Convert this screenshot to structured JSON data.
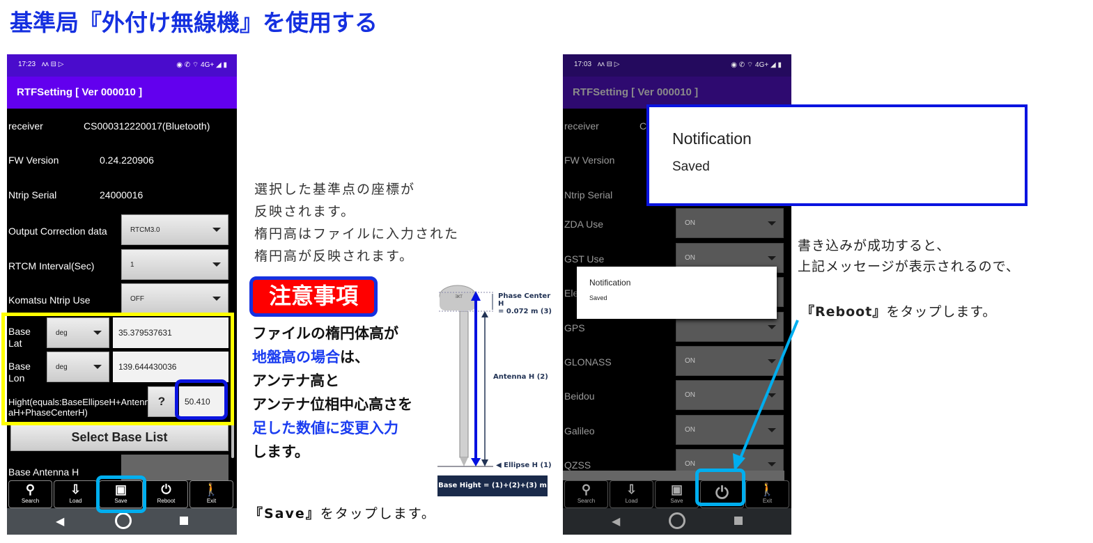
{
  "page_title": "基準局『外付け無線機』を使用する",
  "left_phone": {
    "status_time": "17:23",
    "status_icons": "◉ ✆ ⌔ 4G+ ◢ ▮",
    "app_title": "RTFSetting  [ Ver 000010 ]",
    "rows": [
      {
        "label": "receiver",
        "value": "CS000312220017(Bluetooth)"
      },
      {
        "label": "FW Version",
        "value": "0.24.220906"
      },
      {
        "label": "Ntrip Serial",
        "value": "24000016"
      }
    ],
    "dropdowns": [
      {
        "label": "Output Correction data",
        "value": "RTCM3.0"
      },
      {
        "label": "RTCM Interval(Sec)",
        "value": "1"
      },
      {
        "label": "Komatsu Ntrip Use",
        "value": "OFF"
      }
    ],
    "base_lat": {
      "label": "Base Lat",
      "unit": "deg",
      "value": "35.379537631"
    },
    "base_lon": {
      "label": "Base Lon",
      "unit": "deg",
      "value": "139.644430036"
    },
    "hight": {
      "label": "Hight(equals:BaseEllipseH+AntennaH+PhaseCenterH)",
      "help": "?",
      "value": "50.410"
    },
    "select_base_list": "Select Base List",
    "base_antenna_h": "Base Antenna H"
  },
  "toolbar": [
    {
      "label": "Search",
      "icon": "search-icon"
    },
    {
      "label": "Load",
      "icon": "load-icon"
    },
    {
      "label": "Save",
      "icon": "save-icon"
    },
    {
      "label": "Reboot",
      "icon": "power-icon"
    },
    {
      "label": "Exit",
      "icon": "exit-icon"
    }
  ],
  "middle": {
    "caption_lines": [
      "選択した基準点の座標が",
      "反映されます。",
      "楕円高はファイルに入力された",
      "楕円高が反映されます。"
    ],
    "caution_badge": "注意事項",
    "caution": {
      "l1": "ファイルの楕円体高が",
      "l2_blue": "地盤高の場合",
      "l2_rest": "は、",
      "l3": "アンテナ高と",
      "l4": "アンテナ位相中心高さを",
      "l5_blue": "足した数値に変更入力",
      "l6": "します。"
    },
    "save_caption_bold": "『Save』",
    "save_caption_rest": "をタップします。"
  },
  "diagram": {
    "phase_center": "Phase Center H",
    "phase_value": "= 0.072 m (3)",
    "antenna_h": "Antenna H (2)",
    "ellipse_h": "◀ Ellipse H (1)",
    "formula": "Base Hight = (1)+(2)+(3) m",
    "brand": "∃KT"
  },
  "right_phone": {
    "status_time": "17:03",
    "app_title": "RTFSetting  [ Ver 000010 ]",
    "rows": [
      {
        "label": "receiver"
      },
      {
        "label": "FW Version"
      },
      {
        "label": "Ntrip Serial"
      }
    ],
    "receiver_partial": "C",
    "dropdowns": [
      {
        "label": "ZDA Use",
        "value": "ON"
      },
      {
        "label": "GST Use",
        "value": "ON"
      },
      {
        "label": "Ele",
        "value": ""
      },
      {
        "label": "GPS",
        "value": ""
      },
      {
        "label": "GLONASS",
        "value": "ON"
      },
      {
        "label": "Beidou",
        "value": "ON"
      },
      {
        "label": "Galileo",
        "value": "ON"
      },
      {
        "label": "QZSS",
        "value": "ON"
      }
    ],
    "dialog": {
      "title": "Notification",
      "message": "Saved"
    }
  },
  "zoomed_dialog": {
    "title": "Notification",
    "message": "Saved"
  },
  "right_caption": {
    "l1": "書き込みが成功すると、",
    "l2": "上記メッセージが表示されるので、",
    "l3_bold": "『Reboot』",
    "l3_rest": "をタップします。"
  },
  "colors": {
    "accent_blue": "#1530e0",
    "highlight_yellow": "#ffff00",
    "highlight_cyan": "#00aeef",
    "caution_red": "#ff0000",
    "app_purple": "#6200ee"
  }
}
